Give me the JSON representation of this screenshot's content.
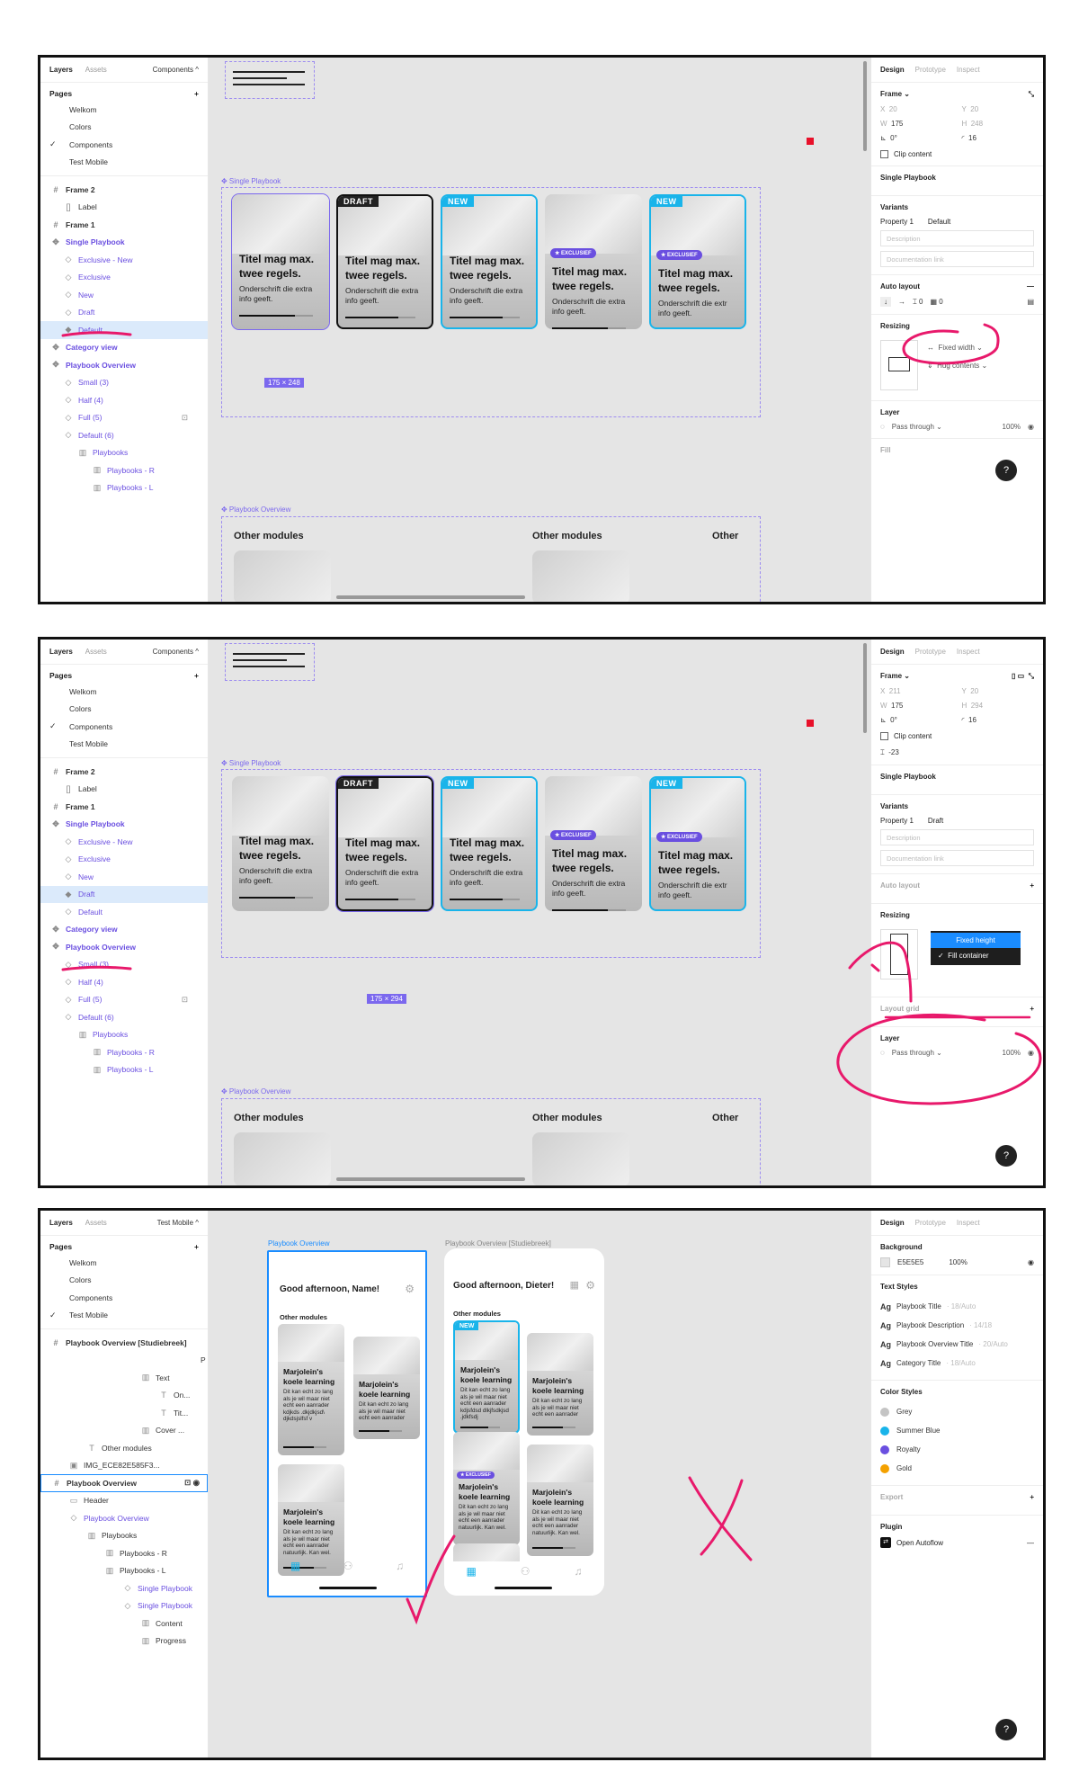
{
  "panel1": {
    "left_tabs": [
      "Layers",
      "Assets"
    ],
    "page_selector": "Components ^",
    "pages_title": "Pages",
    "pages": [
      "Welkom",
      "Colors",
      "Components",
      "Test Mobile"
    ],
    "active_page": "Components",
    "layers": [
      {
        "label": "Frame 2",
        "glyph": "#"
      },
      {
        "label": "Label",
        "glyph": "[]"
      },
      {
        "label": "Frame 1",
        "glyph": "#"
      },
      {
        "label": "Single Playbook",
        "glyph": "✥"
      },
      {
        "label": "Exclusive - New",
        "glyph": "◇"
      },
      {
        "label": "Exclusive",
        "glyph": "◇"
      },
      {
        "label": "New",
        "glyph": "◇"
      },
      {
        "label": "Draft",
        "glyph": "◇"
      },
      {
        "label": "Default",
        "glyph": "◆"
      },
      {
        "label": "Category view",
        "glyph": "✥"
      },
      {
        "label": "Playbook Overview",
        "glyph": "✥"
      },
      {
        "label": "Small (3)",
        "glyph": "◇"
      },
      {
        "label": "Half (4)",
        "glyph": "◇"
      },
      {
        "label": "Full (5)",
        "glyph": "◇"
      },
      {
        "label": "Default (6)",
        "glyph": "◇"
      },
      {
        "label": "Playbooks",
        "glyph": "▥"
      },
      {
        "label": "Playbooks - R",
        "glyph": "▥"
      },
      {
        "label": "Playbooks - L",
        "glyph": "▥"
      }
    ],
    "right_tabs": [
      "Design",
      "Prototype",
      "Inspect"
    ],
    "frame_label": "Frame ⌄",
    "fields": {
      "x_label": "X",
      "x": "20",
      "y_label": "Y",
      "y": "20",
      "w_label": "W",
      "w": "175",
      "h_label": "H",
      "h": "248",
      "rot": "0°",
      "radius": "16"
    },
    "clip_content": "Clip content",
    "component_name": "Single Playbook",
    "variants_title": "Variants",
    "property_label": "Property 1",
    "property_value": "Default",
    "description_placeholder": "Description",
    "doc_link_placeholder": "Documentation link",
    "auto_layout_title": "Auto layout",
    "auto_spacing": "0",
    "auto_padding": "0",
    "resizing_title": "Resizing",
    "fixed_width": "Fixed width ⌄",
    "hug_contents": "Hug contents ⌄",
    "layer_title": "Layer",
    "blend": "Pass through ⌄",
    "opacity": "100%",
    "fill_title": "Fill",
    "size_badge": "175 × 248",
    "single_playbook_label": "✥ Single Playbook",
    "overview_label": "✥ Playbook Overview",
    "other_modules": [
      "Other modules",
      "Other modules",
      "Other"
    ],
    "cards": [
      {
        "tag": "",
        "excl": "",
        "title": "Titel mag max. twee regels.",
        "desc": "Onderschrift die extra info geeft."
      },
      {
        "tag": "DRAFT",
        "excl": "",
        "title": "Titel mag max. twee regels.",
        "desc": "Onderschrift die extra info geeft."
      },
      {
        "tag": "NEW",
        "excl": "",
        "title": "Titel mag max. twee regels.",
        "desc": "Onderschrift die extra info geeft."
      },
      {
        "tag": "",
        "excl": "★ EXCLUSIEF",
        "title": "Titel mag max. twee regels.",
        "desc": "Onderschrift die extra info geeft."
      },
      {
        "tag": "NEW",
        "excl": "★ EXCLUSIEF",
        "title": "Titel mag max. twee regels.",
        "desc": "Onderschrift die extr info geeft."
      }
    ]
  },
  "panel2": {
    "left_tabs": [
      "Layers",
      "Assets"
    ],
    "page_selector": "Components ^",
    "pages_title": "Pages",
    "pages": [
      "Welkom",
      "Colors",
      "Components",
      "Test Mobile"
    ],
    "active_page": "Components",
    "layers": [
      {
        "label": "Frame 2",
        "glyph": "#"
      },
      {
        "label": "Label",
        "glyph": "[]"
      },
      {
        "label": "Frame 1",
        "glyph": "#"
      },
      {
        "label": "Single Playbook",
        "glyph": "✥"
      },
      {
        "label": "Exclusive - New",
        "glyph": "◇"
      },
      {
        "label": "Exclusive",
        "glyph": "◇"
      },
      {
        "label": "New",
        "glyph": "◇"
      },
      {
        "label": "Draft",
        "glyph": "◆"
      },
      {
        "label": "Default",
        "glyph": "◇"
      },
      {
        "label": "Category view",
        "glyph": "✥"
      },
      {
        "label": "Playbook Overview",
        "glyph": "✥"
      },
      {
        "label": "Small (3)",
        "glyph": "◇"
      },
      {
        "label": "Half (4)",
        "glyph": "◇"
      },
      {
        "label": "Full (5)",
        "glyph": "◇"
      },
      {
        "label": "Default (6)",
        "glyph": "◇"
      },
      {
        "label": "Playbooks",
        "glyph": "▥"
      },
      {
        "label": "Playbooks - R",
        "glyph": "▥"
      },
      {
        "label": "Playbooks - L",
        "glyph": "▥"
      }
    ],
    "right_tabs": [
      "Design",
      "Prototype",
      "Inspect"
    ],
    "frame_label": "Frame ⌄",
    "fields": {
      "x_label": "X",
      "x": "211",
      "y_label": "Y",
      "y": "20",
      "w_label": "W",
      "w": "175",
      "h_label": "H",
      "h": "294",
      "rot": "0°",
      "radius": "16"
    },
    "clip_content": "Clip content",
    "spacing_value": "-23",
    "component_name": "Single Playbook",
    "variants_title": "Variants",
    "property_label": "Property 1",
    "property_value": "Draft",
    "description_placeholder": "Description",
    "doc_link_placeholder": "Documentation link",
    "auto_layout_title": "Auto layout",
    "resizing_title": "Resizing",
    "menu_fixed_height": "Fixed height",
    "menu_fill_container": "Fill container",
    "layout_grid_title": "Layout grid",
    "layer_title": "Layer",
    "blend": "Pass through ⌄",
    "opacity": "100%",
    "size_badge": "175 × 294",
    "single_playbook_label": "✥ Single Playbook",
    "overview_label": "✥ Playbook Overview",
    "other_modules": [
      "Other modules",
      "Other modules",
      "Other"
    ],
    "cards": [
      {
        "tag": "",
        "excl": "",
        "title": "Titel mag max. twee regels.",
        "desc": "Onderschrift die extra info geeft."
      },
      {
        "tag": "DRAFT",
        "excl": "",
        "title": "Titel mag max. twee regels.",
        "desc": "Onderschrift die extra info geeft."
      },
      {
        "tag": "NEW",
        "excl": "",
        "title": "Titel mag max. twee regels.",
        "desc": "Onderschrift die extra info geeft."
      },
      {
        "tag": "",
        "excl": "★ EXCLUSIEF",
        "title": "Titel mag max. twee regels.",
        "desc": "Onderschrift die extra info geeft."
      },
      {
        "tag": "NEW",
        "excl": "★ EXCLUSIEF",
        "title": "Titel mag max. twee regels.",
        "desc": "Onderschrift die extr info geeft."
      }
    ]
  },
  "panel3": {
    "left_tabs": [
      "Layers",
      "Assets"
    ],
    "page_selector": "Test Mobile ^",
    "pages_title": "Pages",
    "pages": [
      "Welkom",
      "Colors",
      "Components",
      "Test Mobile"
    ],
    "active_page": "Test Mobile",
    "layers": [
      {
        "label": "Playbook Overview [Studiebreek]",
        "glyph": "#",
        "indent": 0
      },
      {
        "label": "P",
        "glyph": "",
        "indent": 150
      },
      {
        "label": "Text",
        "glyph": "▥",
        "indent": 100
      },
      {
        "label": "On...",
        "glyph": "T",
        "indent": 120
      },
      {
        "label": "Tit...",
        "glyph": "T",
        "indent": 120
      },
      {
        "label": "Cover ...",
        "glyph": "▥",
        "indent": 100
      },
      {
        "label": "Other modules",
        "glyph": "T",
        "indent": 40
      },
      {
        "label": "IMG_ECE82E585F3...",
        "glyph": "▣",
        "indent": 20
      },
      {
        "label": "Playbook Overview",
        "glyph": "#",
        "indent": 0
      },
      {
        "label": "Header",
        "glyph": "▭",
        "indent": 20
      },
      {
        "label": "Playbook Overview",
        "glyph": "◇",
        "indent": 20
      },
      {
        "label": "Playbooks",
        "glyph": "▥",
        "indent": 40
      },
      {
        "label": "Playbooks - R",
        "glyph": "▥",
        "indent": 60
      },
      {
        "label": "Playbooks - L",
        "glyph": "▥",
        "indent": 60
      },
      {
        "label": "Single Playbook",
        "glyph": "◇",
        "indent": 80
      },
      {
        "label": "Single Playbook",
        "glyph": "◇",
        "indent": 80
      },
      {
        "label": "Content",
        "glyph": "▥",
        "indent": 100
      },
      {
        "label": "Progress",
        "glyph": "▥",
        "indent": 100
      }
    ],
    "right_tabs": [
      "Design",
      "Prototype",
      "Inspect"
    ],
    "background_title": "Background",
    "bg_hex": "E5E5E5",
    "bg_opacity": "100%",
    "text_styles_title": "Text Styles",
    "text_styles": [
      {
        "name": "Playbook Title",
        "meta": "· 18/Auto"
      },
      {
        "name": "Playbook Description",
        "meta": "· 14/18"
      },
      {
        "name": "Playbook Overview Title",
        "meta": "· 20/Auto"
      },
      {
        "name": "Category Title",
        "meta": "· 18/Auto"
      }
    ],
    "ag": "Ag",
    "color_styles_title": "Color Styles",
    "color_styles": [
      {
        "name": "Grey",
        "color": "#c4c4c4"
      },
      {
        "name": "Summer Blue",
        "color": "#19b4ea"
      },
      {
        "name": "Royalty",
        "color": "#6a4fe0"
      },
      {
        "name": "Gold",
        "color": "#f4a100"
      }
    ],
    "export_title": "Export",
    "plugin_title": "Plugin",
    "plugin_name": "Open Autoflow",
    "frame1_label": "Playbook Overview",
    "frame2_label": "Playbook Overview [Studiebreek]",
    "greeting1": "Good afternoon, Name!",
    "greeting2": "Good afternoon, Dieter!",
    "other_modules": "Other modules",
    "card_title": "Marjolein's koele learning",
    "card_descs": [
      "Dit kan echt zo lang als je wil maar niet echt een aanrader kdjkds .dkjdkjsd\\ djkdsjslfsf v",
      "Dit kan echt zo lang als je wil maar niet echt een aanrader",
      "Dit kan echt zo lang als je wil maar niet echt een aanrader natuurlijk. Kan wel.",
      "Dit kan echt zo lang als je wil maar niet echt een aanrader kdjsfdsd dlkjfsdkjsd .jdkfsdj",
      "Dit kan echt zo lang als je wil maar niet echt een aanrader",
      "Dit kan echt zo lang als je wil maar niet echt een aanrader natuurlijk. Kan wel.",
      "Dit kan echt zo lang als je wil maar niet echt een aanrader natuurlijk. Kan wel."
    ],
    "new_tag": "NEW",
    "excl_tag": "★ EXCLUSIEF"
  },
  "help_label": "?",
  "colors": {
    "accent": "#6a4fe0",
    "blue": "#19b4ea",
    "annotation": "#e8196b",
    "selection": "#dbeafb"
  }
}
